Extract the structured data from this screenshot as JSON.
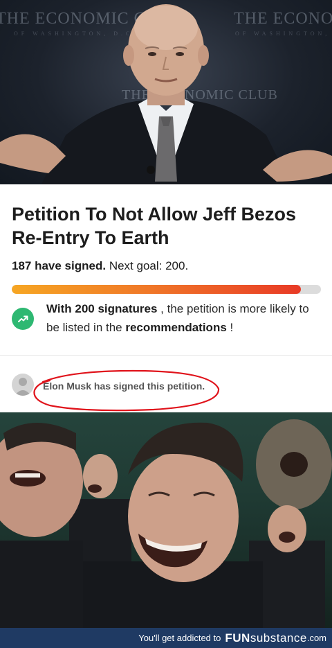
{
  "top_photo": {
    "banner_text": "THE ECONOMIC CLUB",
    "banner_sub": "OF WASHINGTON, D.C."
  },
  "petition": {
    "title": "Petition To Not Allow Jeff Bezos Re-Entry To Earth",
    "signed_count_text": "187 have signed.",
    "next_goal_text": "Next goal: 200.",
    "signed": 187,
    "goal": 200,
    "progress_fraction": 0.935,
    "rec_bold_1": "With 200 signatures",
    "rec_text_1": " , the petition is more likely to be listed in the ",
    "rec_bold_2": "recommendations",
    "rec_text_2": " !",
    "trend_icon": "trending-up-icon",
    "accent_green": "#2eb872"
  },
  "signer": {
    "text": "Elon Musk has signed this petition.",
    "annotation_color": "#e0131b"
  },
  "footer": {
    "addicted_text": "You'll get addicted to",
    "brand_bold": "FUN",
    "brand_light": "substance",
    "brand_suffix": ".com",
    "bg_color": "#1f3a63"
  }
}
